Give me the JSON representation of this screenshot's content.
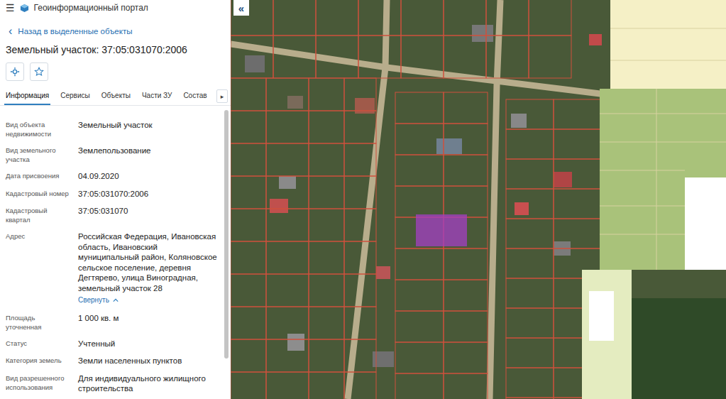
{
  "header": {
    "menu_icon": "☰",
    "title": "Геоинформационный портал"
  },
  "back_link": {
    "icon": "‹",
    "label": "Назад в выделенные объекты"
  },
  "object_title": "Земельный участок: 37:05:031070:2006",
  "tabs": [
    {
      "label": "Информация",
      "selected": true
    },
    {
      "label": "Сервисы",
      "selected": false
    },
    {
      "label": "Объекты",
      "selected": false
    },
    {
      "label": "Части ЗУ",
      "selected": false
    },
    {
      "label": "Состав",
      "selected": false
    }
  ],
  "tabs_scroll": "▸",
  "fields": [
    {
      "label": "Вид объекта недвижимости",
      "value": "Земельный участок",
      "action": ""
    },
    {
      "label": "Вид земельного участка",
      "value": "Землепользование",
      "action": ""
    },
    {
      "label": "Дата присвоения",
      "value": "04.09.2020",
      "action": ""
    },
    {
      "label": "Кадастровый номер",
      "value": "37:05:031070:2006",
      "action": ""
    },
    {
      "label": "Кадастровый квартал",
      "value": "37:05:031070",
      "action": ""
    },
    {
      "label": "Адрес",
      "value": "Российская Федерация, Ивановская область, Ивановский муниципальный район, Коляновское сельское поселение, деревня Дегтярево, улица Виноградная, земельный участок 28",
      "action": "Свернуть"
    },
    {
      "label": "Площадь уточненная",
      "value": "1 000 кв. м",
      "action": ""
    },
    {
      "label": "Статус",
      "value": "Учтенный",
      "action": ""
    },
    {
      "label": "Категория земель",
      "value": "Земли населенных пунктов",
      "action": ""
    },
    {
      "label": "Вид разрешенного использования",
      "value": "Для индивидуального жилищного строительства",
      "action": ""
    }
  ],
  "map": {
    "collapse_button": "«"
  }
}
